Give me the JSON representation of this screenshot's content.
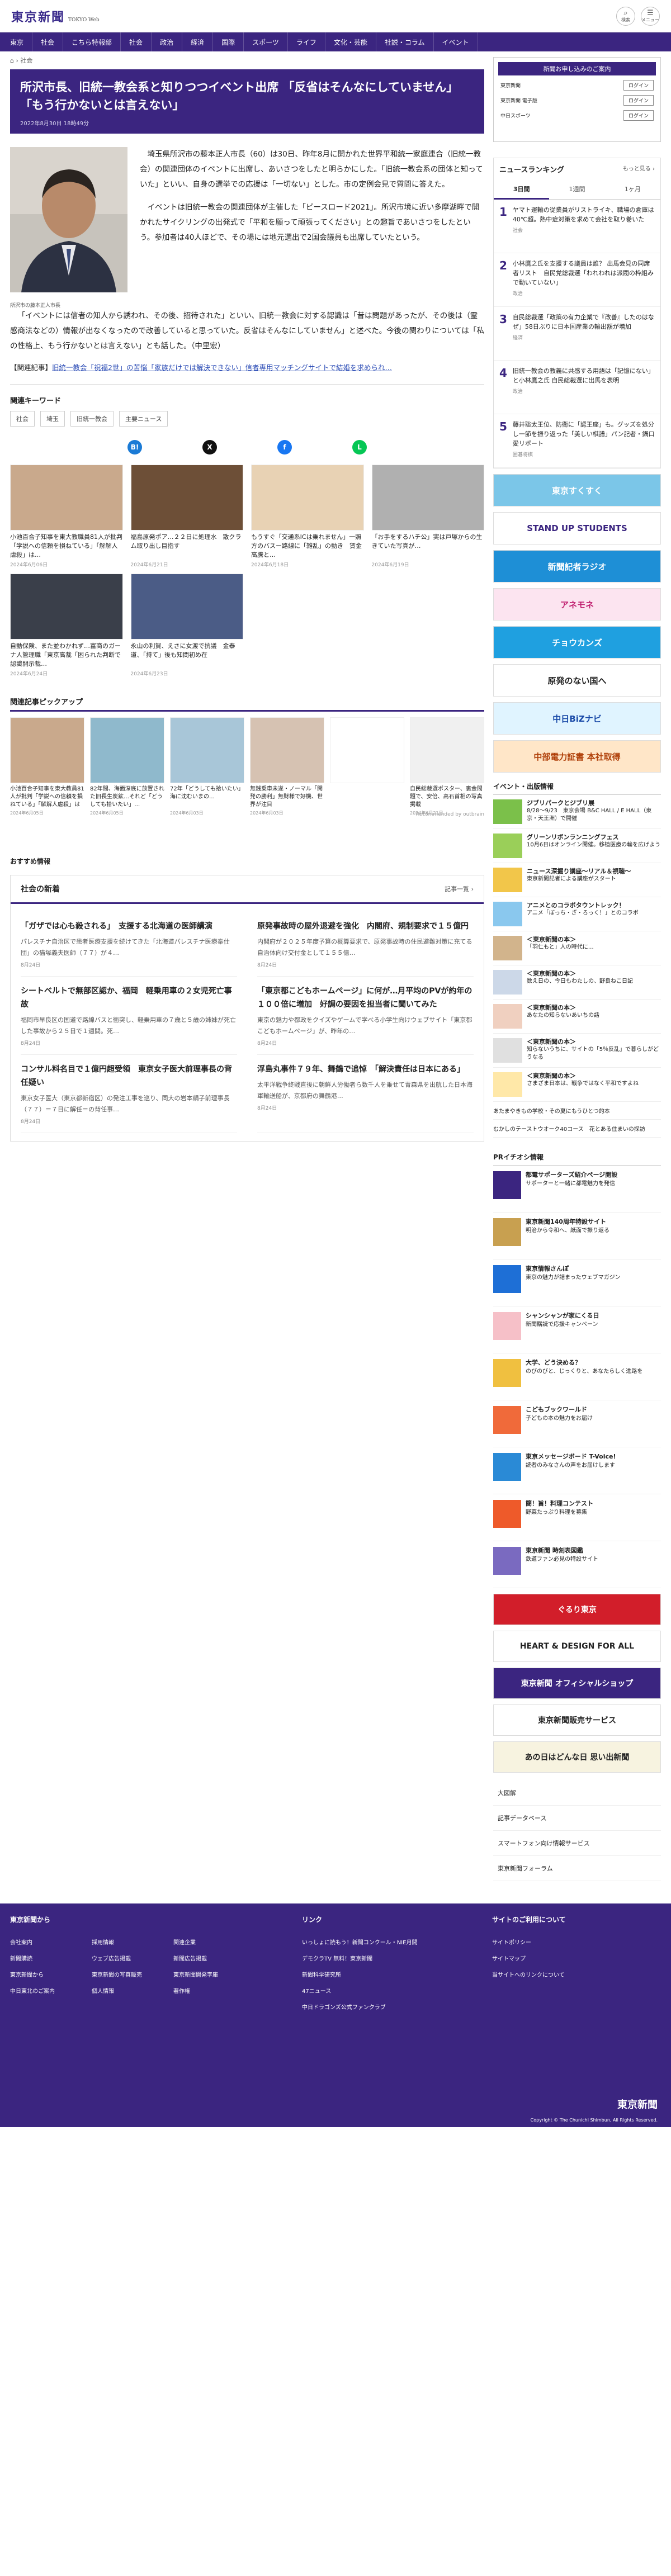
{
  "brand": {
    "logo": "東京新聞",
    "sub": "TOKYO Web"
  },
  "header": {
    "search_label": "検索",
    "menu_label": "メニュー"
  },
  "nav": [
    "東京",
    "社会",
    "こちら特報部",
    "社会",
    "政治",
    "経済",
    "国際",
    "スポーツ",
    "ライフ",
    "文化・芸能",
    "社説・コラム",
    "イベント"
  ],
  "breadcrumb": [
    "⌂",
    "社会"
  ],
  "article": {
    "title": "所沢市長、旧統一教会系と知りつつイベント出席 「反省はそんなにしていません」「もう行かないとは言えない」",
    "date": "2022年8月30日 18時49分",
    "caption": "所沢市の藤本正人市長",
    "paras_right": [
      "埼玉県所沢市の藤本正人市長（60）は30日、昨年8月に開かれた世界平和統一家庭連合（旧統一教会）の関連団体のイベントに出席し、あいさつをしたと明らかにした。「旧統一教会系の団体と知っていた」といい、自身の選挙での応援は「一切ない」とした。市の定例会見で質問に答えた。",
      "イベントは旧統一教会の関連団体が主催した「ピースロード2021」。所沢市境に近い多摩湖畔で開かれたサイクリングの出発式で「平和を願って頑張ってください」との趣旨であいさつをしたという。参加者は40人ほどで、その場には地元選出で2国会議員も出席していたという。"
    ],
    "paras_full": [
      "「イベントには信者の知人から誘われ、その後、招待された」といい、旧統一教会に対する認識は「昔は問題があったが、その後は（霊感商法などの）情報が出なくなったので改善していると思っていた。反省はそんなにしていません」と述べた。今後の関わりについては「私の性格上、もう行かないとは言えない」とも話した。（中里宏）"
    ],
    "related_label": "【関連記事】",
    "related_link": "旧統一教会「祝福2世」の苦悩「家族だけでは解決できない」信者専用マッチングサイトで結婚を求められ…"
  },
  "keywords": {
    "title": "関連キーワード",
    "tags": [
      "社会",
      "埼玉",
      "旧統一教会",
      "主要ニュース"
    ]
  },
  "share": [
    {
      "icon": "b-icon",
      "label": "B!",
      "color": "#1b7bd6"
    },
    {
      "icon": "x-icon",
      "label": "X",
      "color": "#111"
    },
    {
      "icon": "facebook-icon",
      "label": "f",
      "color": "#1877f2"
    },
    {
      "icon": "line-icon",
      "label": "L",
      "color": "#06c755"
    }
  ],
  "related_cards": [
    {
      "t": "小池百合子知事を東大教職員81人が批判「学説への信頼を損ねている」「解解人虐殺」は…",
      "d": "2024年6月06日",
      "c": "#c9a98c"
    },
    {
      "t": "福島原発ポア…２２日に処理水　散クラム取り出し目指す",
      "d": "2024年6月21日",
      "c": "#6d4f37"
    },
    {
      "t": "もうすぐ「交通系ICは乗れません」一照方のバスー路線に「雑乱」の動き　賃金高騰と…",
      "d": "2024年6月18日",
      "c": "#e8d2b4"
    },
    {
      "t": "「お手をするハチ公」実は戸塚からの生きていた写真が…",
      "d": "2024年6月19日",
      "c": "#b0b0b0"
    },
    {
      "t": "自動保険、また並わかれず…富商のガーナ人管理職「東京高裁「困られた判断で認識開示裁…",
      "d": "2024年6月24日",
      "c": "#3a3f4a"
    },
    {
      "t": "永山の利賀、えさに女渡で抗議　金泰道、「持て」後も知問初め在",
      "d": "2024年6月23日",
      "c": "#4b5c86"
    }
  ],
  "pickup": {
    "title": "関連記事ピックアップ",
    "cards": [
      {
        "t": "小池百合子知事を東大教員81人が批判「学説への信頼を損ねている」「解解人虐殺」はっ…",
        "d": "2024年6月05日",
        "c": "#c9a98c"
      },
      {
        "t": "82年間、海面深底に放置された旧長生炭鉱…それど「どうしても拾いたい」…",
        "d": "2024年6月05日",
        "c": "#8fb9cc"
      },
      {
        "t": "72年「どうしても拾いたい」　海に沈むいまの…",
        "d": "2024年6月03日",
        "c": "#a8c6d8"
      },
      {
        "t": "無銭乗車未遂・ノーマル「開発の勝利」無財様で好機、世界が注目",
        "d": "2024年6月03日",
        "c": "#d6c2b2"
      },
      {
        "t": "",
        "d": "",
        "c": "#ffffff"
      },
      {
        "t": "自民総裁選ポスター、裏金問題で、安倍、高石首相の写真掲載",
        "d": "2024年6月21日",
        "c": "#f0f0f0"
      }
    ],
    "recommend": "Recommended by outbrain"
  },
  "osusume": "おすすめ情報",
  "social": {
    "title": "社会の新着",
    "more": "記事一覧 ›",
    "items": [
      {
        "h": "「ガザでは心も殺される」　支援する北海道の医師講演",
        "p": "パレスチナ自治区で患者医療支援を続けてきた「北海道パレスチナ医療奉仕団」の猫塚義夫医師（７７）が４…",
        "d": "8月24日"
      },
      {
        "h": "原発事故時の屋外退避を強化　内閣府、規制要求で１５億円",
        "p": "内閣府が２０２５年度予算の概算要求で、原発事故時の住民避難対策に充てる自治体向け交付金として１５５億…",
        "d": "8月24日"
      },
      {
        "h": "シートベルトで無部区認か、福岡　軽乗用車の２女児死亡事故",
        "p": "福岡市早良区の国道で路線バスと衝突し、軽乗用車の７歳と５歳の姉妹が死亡した事故から２５日で１週間。死…",
        "d": "8月24日"
      },
      {
        "h": "「東京都こどもホームページ」に何が…月平均のPVが約年の１００倍に増加　好調の要因を担当者に聞いてみた",
        "p": "東京の魅力や都政をクイズやゲームで学べる小学生向けウェブサイト「東京都こどもホームページ」が、昨年の…",
        "d": "8月24日"
      },
      {
        "h": "コンサル料名目で１億円超受領　東京女子医大前理事長の背任疑い",
        "p": "東京女子医大（東京都新宿区）の発注工事を巡り、同大の岩本絹子前理事長（７７）＝７日に解任＝の背任事…",
        "d": "8月24日"
      },
      {
        "h": "浮島丸事件７９年、舞鶴で追悼　「解決責任は日本にある」",
        "p": "太平洋戦争終戦直後に朝鮮人労働者ら数千人を乗せて青森県を出航した日本海軍輸送船が、京都府の舞鶴港…",
        "d": "8月24日"
      }
    ]
  },
  "side": {
    "ad_title": "新聞お申し込みのご案内",
    "ad_rows": [
      {
        "l": "東京新聞",
        "b": "ログイン"
      },
      {
        "l": "東京新聞 電子版",
        "b": "ログイン"
      },
      {
        "l": "中日スポーツ",
        "b": "ログイン"
      }
    ],
    "ranking": {
      "title": "ニュースランキング",
      "more": "もっと見る ›",
      "tabs": [
        "3日間",
        "1週間",
        "1ヶ月"
      ],
      "items": [
        {
          "t": "ヤマト運輸の従業員がリストライキ、職場の倉庫は40℃超。熱中症対策を求めて会社を取り巻いた",
          "c": "社会"
        },
        {
          "t": "小林鷹之氏を支援する議員は誰？ 出馬会見の同席者リスト　自民党総裁選「われわれは派閥の枠組みで動いていない」",
          "c": "政治"
        },
        {
          "t": "自民総裁選「政策の有力企業で『改善』したのはなぜ」58日ぶりに日本国産業の輸出額が増加",
          "c": "経済"
        },
        {
          "t": "旧統一教会の教義に共感する用語は「記憶にない」と小林鷹之氏 自民総裁選に出馬を表明",
          "c": "政治"
        },
        {
          "t": "藤井聡太王位、防衛に「認王座」も。グッズを処分し一節を振り返った「美しい棋譜」パン記者・鍋口愛リポート",
          "c": "囲碁将棋"
        }
      ]
    },
    "banners": [
      {
        "t": "東京すくすく",
        "bg": "#7bc6e8",
        "fg": "#fff"
      },
      {
        "t": "STAND UP STUDENTS",
        "bg": "#fff",
        "fg": "#3b2580"
      },
      {
        "t": "新聞記者ラジオ",
        "bg": "#1e8fd6",
        "fg": "#fff"
      },
      {
        "t": "アネモネ",
        "bg": "#fce4f0",
        "fg": "#c02070"
      },
      {
        "t": "チョウカンズ",
        "bg": "#1fa0e0",
        "fg": "#fff"
      },
      {
        "t": "原発のない国へ",
        "bg": "#fff",
        "fg": "#222"
      },
      {
        "t": "中日BiZナビ",
        "bg": "#e0f4ff",
        "fg": "#1a4aa8"
      },
      {
        "t": "中部電力証書 本社取得",
        "bg": "#ffe6c8",
        "fg": "#b0400a"
      }
    ],
    "events": {
      "title": "イベント・出版情報",
      "items": [
        {
          "b": "ジブリパークとジブリ展",
          "s": "8/28〜9/23　東京会場 B&C HALL / E HALL（東京・天王洲）で開催",
          "c": "#7bc04a"
        },
        {
          "b": "グリーンリボンランニングフェス",
          "s": "10月6日はオンライン開催。移植医療の輪を広げよう",
          "c": "#9acf59"
        },
        {
          "b": "ニュース深掘り講座〜リアル＆視聴〜",
          "s": "東京新聞記者による講座がスタート",
          "c": "#f2c64a"
        },
        {
          "b": "アニメとのコラボタウントレック！",
          "s": "アニメ「ぼっち・ざ・ろっく！」とのコラボ",
          "c": "#8ac8ee"
        },
        {
          "b": "＜東京新聞の本＞",
          "s": "「羽仁もと」人の時代に…",
          "c": "#d2b48c"
        },
        {
          "b": "＜東京新聞の本＞",
          "s": "数え日の、今日もわたしの、野良ねこ日記",
          "c": "#ccd8e8"
        },
        {
          "b": "＜東京新聞の本＞",
          "s": "あなたの知らないあいちの話",
          "c": "#f0d0c0"
        },
        {
          "b": "＜東京新聞の本＞",
          "s": "知らないうちに、サイトの「5％反乱」で暮らしがどうなる",
          "c": "#e0e0e0"
        },
        {
          "b": "＜東京新聞の本＞",
          "s": "さまざま日本は、戦争ではなく平和ですよね",
          "c": "#ffe8a8"
        }
      ],
      "links": [
        "あたまやきもの学校・その夏にもうひとつ的本",
        "むかしのテーストウオーク40コース　花とある住まいの探訪"
      ]
    },
    "pr": {
      "title": "PRイチオシ情報",
      "items": [
        {
          "b": "都電サポーターズ紹介ページ開設",
          "s": "サポーターと一緒に都電魅力を発信",
          "c": "#3b2580"
        },
        {
          "b": "東京新聞140周年特設サイト",
          "s": "明治から令和へ、紙面で振り返る",
          "c": "#c8a050"
        },
        {
          "b": "東京情報さんぽ",
          "s": "東京の魅力が詰まったウェブマガジン",
          "c": "#1e6fd6"
        },
        {
          "b": "シャンシャンが家にくる日",
          "s": "新聞購読で応援キャンペーン",
          "c": "#f6c0c8"
        },
        {
          "b": "大学、どう決める？",
          "s": "のびのびと、じっくりと、あなたらしく進路を",
          "c": "#f0c040"
        },
        {
          "b": "こどもブックワールド",
          "s": "子どもの本の魅力をお届け",
          "c": "#f06a3a"
        },
        {
          "b": "東京メッセージボード T-Voice!",
          "s": "読者のみなさんの声をお届けします",
          "c": "#2a8ad6"
        },
        {
          "b": "簡！旨！料理コンテスト",
          "s": "野菜たっぷり料理を募集",
          "c": "#ee5a2a"
        },
        {
          "b": "東京新聞 時刻表図鑑",
          "s": "鉄道ファン必見の特設サイト",
          "c": "#7a6ac0"
        }
      ]
    },
    "sbanners": [
      {
        "t": "ぐるり東京",
        "bg": "#d21e2a",
        "fg": "#fff"
      },
      {
        "t": "HEART & DESIGN FOR ALL",
        "bg": "#fff",
        "fg": "#222"
      },
      {
        "t": "東京新聞 オフィシャルショップ",
        "bg": "#3b2580",
        "fg": "#fff"
      },
      {
        "t": "東京新聞販売サービス",
        "bg": "#fff",
        "fg": "#222"
      },
      {
        "t": "あの日はどんな日 思い出新聞",
        "bg": "#f7f3e0",
        "fg": "#222"
      }
    ],
    "slinks": [
      "大図解",
      "記事データベース",
      "スマートフォン向け情報サービス",
      "東京新聞フォーラム"
    ]
  },
  "footer": {
    "col1_title": "東京新聞から",
    "col1": [
      "会社案内",
      "採用情報",
      "関連企業",
      "新聞購読",
      "ウェブ広告掲載",
      "新聞広告掲載",
      "東京新聞から",
      "東京新聞の写真販売",
      "東京新聞開発字庫",
      "中日東北のご案内",
      "個人情報",
      "著作権"
    ],
    "col2_title": "リンク",
    "col2": [
      "いっしょに読もう！新聞コンクール・NIE月間",
      "デモクラTV 無料！東京新聞",
      "新聞科学研究所",
      "47ニュース",
      "中日ドラゴンズ公式ファンクラブ"
    ],
    "col3_title": "サイトのご利用について",
    "col3": [
      "サイトポリシー",
      "サイトマップ",
      "当サイトへのリンクについて"
    ],
    "logo": "東京新聞",
    "copy": "Copyright © The Chunichi Shimbun, All Rights Reserved."
  }
}
